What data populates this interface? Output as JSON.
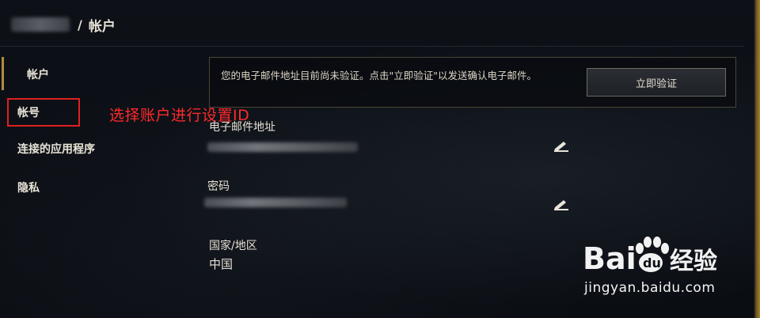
{
  "header": {
    "separator": "/",
    "title": "帐户"
  },
  "sidebar": {
    "items": [
      {
        "label": "帐户"
      },
      {
        "label": "帐号"
      },
      {
        "label": "连接的应用程序"
      },
      {
        "label": "隐私"
      }
    ]
  },
  "annotation": {
    "text": "选择账户进行设置ID",
    "color": "#ff2a2a"
  },
  "notice": {
    "text": "您的电子邮件地址目前尚未验证。点击\"立即验证\"以发送确认电子邮件。",
    "button_label": "立即验证"
  },
  "fields": {
    "email_label": "电子邮件地址",
    "password_label": "密码",
    "country_label": "国家/地区",
    "country_value": "中国"
  },
  "icons": {
    "edit": "pencil-icon"
  },
  "watermark": {
    "logo_text": "Bai  du 经验",
    "url": "jingyan.baidu.com"
  },
  "colors": {
    "accent_gold": "#b08d3a",
    "background": "#0a0d12",
    "annotation_red": "#e02020"
  }
}
